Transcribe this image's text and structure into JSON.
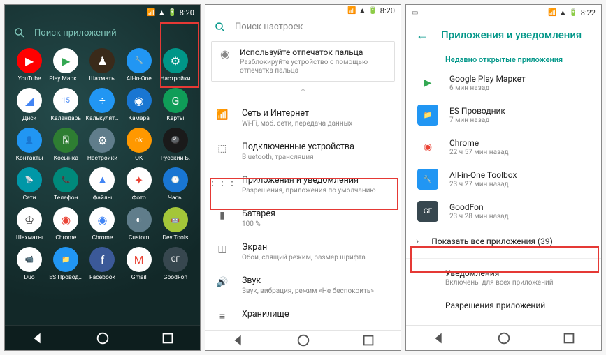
{
  "status": {
    "time1": "8:20",
    "time2": "8:20",
    "time3": "8:22"
  },
  "screen1": {
    "search": "Поиск приложений",
    "apps": [
      {
        "name": "YouTube",
        "bg": "#ff0000",
        "glyph": "▶"
      },
      {
        "name": "Play Маркет",
        "bg": "#ffffff",
        "glyph": "▶",
        "fg": "#34a853"
      },
      {
        "name": "Шахматы",
        "bg": "#3a2a1a",
        "glyph": "♟"
      },
      {
        "name": "All-in-One",
        "bg": "#2196f3",
        "glyph": "🔧"
      },
      {
        "name": "Настройки",
        "bg": "#009688",
        "glyph": "⚙"
      },
      {
        "name": "Диск",
        "bg": "#ffffff",
        "glyph": "◢",
        "fg": "#4285f4"
      },
      {
        "name": "Календарь",
        "bg": "#ffffff",
        "glyph": "15",
        "fg": "#4285f4"
      },
      {
        "name": "Калькулятор",
        "bg": "#2196f3",
        "glyph": "÷"
      },
      {
        "name": "Камера",
        "bg": "#1976d2",
        "glyph": "◉"
      },
      {
        "name": "Карты",
        "bg": "#0f9d58",
        "glyph": "G"
      },
      {
        "name": "Контакты",
        "bg": "#2196f3",
        "glyph": "👤"
      },
      {
        "name": "Косынка",
        "bg": "#2e7d32",
        "glyph": "🂡"
      },
      {
        "name": "Настройки",
        "bg": "#607d8b",
        "glyph": "⚙"
      },
      {
        "name": "OK",
        "bg": "#ff9800",
        "glyph": "ok"
      },
      {
        "name": "Русский Б.",
        "bg": "#1a1a1a",
        "glyph": "🎱"
      },
      {
        "name": "Сети",
        "bg": "#0097a7",
        "glyph": "📡"
      },
      {
        "name": "Телефон",
        "bg": "#00897b",
        "glyph": "📞"
      },
      {
        "name": "Файлы",
        "bg": "#ffffff",
        "glyph": "▲",
        "fg": "#4285f4"
      },
      {
        "name": "Фото",
        "bg": "#ffffff",
        "glyph": "✦",
        "fg": "#ea4335"
      },
      {
        "name": "Часы",
        "bg": "#1976d2",
        "glyph": "🕐"
      },
      {
        "name": "Шахматы",
        "bg": "#ffffff",
        "glyph": "♔",
        "fg": "#333"
      },
      {
        "name": "Chrome",
        "bg": "#ffffff",
        "glyph": "◉",
        "fg": "#ea4335"
      },
      {
        "name": "Chrome",
        "bg": "#ffffff",
        "glyph": "◉",
        "fg": "#4285f4"
      },
      {
        "name": "Custom",
        "bg": "#607d8b",
        "glyph": "◐"
      },
      {
        "name": "Dev Tools",
        "bg": "#a4c639",
        "glyph": "🤖"
      },
      {
        "name": "Duo",
        "bg": "#ffffff",
        "glyph": "📹",
        "fg": "#1976d2"
      },
      {
        "name": "ES Проводн.",
        "bg": "#2196f3",
        "glyph": "📁"
      },
      {
        "name": "Facebook",
        "bg": "#3b5998",
        "glyph": "f"
      },
      {
        "name": "Gmail",
        "bg": "#ffffff",
        "glyph": "M",
        "fg": "#ea4335"
      },
      {
        "name": "GoodFon",
        "bg": "#37474f",
        "glyph": "GF"
      }
    ]
  },
  "screen2": {
    "search": "Поиск настроек",
    "fingerprint": {
      "title": "Используйте отпечаток пальца",
      "sub": "Разблокируйте устройство с помощью отпечатка пальца"
    },
    "rows": [
      {
        "icon": "wifi",
        "title": "Сеть и Интернет",
        "sub": "Wi-Fi, моб. сети, передача данных"
      },
      {
        "icon": "devices",
        "title": "Подключенные устройства",
        "sub": "Bluetooth, трансляция"
      },
      {
        "icon": "apps",
        "title": "Приложения и уведомления",
        "sub": "Разрешения, приложения по умолчанию"
      },
      {
        "icon": "battery",
        "title": "Батарея",
        "sub": "100 %"
      },
      {
        "icon": "display",
        "title": "Экран",
        "sub": "Обои, спящий режим, размер шрифта"
      },
      {
        "icon": "sound",
        "title": "Звук",
        "sub": "Звук, вибрация, режим «Не беспокоить»"
      },
      {
        "icon": "storage",
        "title": "Хранилище",
        "sub": ""
      }
    ]
  },
  "screen3": {
    "title": "Приложения и уведомления",
    "section": "Недавно открытые приложения",
    "recent": [
      {
        "name": "Google Play Маркет",
        "time": "6 мин назад",
        "bg": "#ffffff",
        "glyph": "▶",
        "fg": "#34a853"
      },
      {
        "name": "ES Проводник",
        "time": "7 мин назад",
        "bg": "#2196f3",
        "glyph": "📁"
      },
      {
        "name": "Chrome",
        "time": "22 ч 57 мин назад",
        "bg": "#ffffff",
        "glyph": "◉",
        "fg": "#ea4335"
      },
      {
        "name": "All-in-One Toolbox",
        "time": "23 ч 27 мин назад",
        "bg": "#2196f3",
        "glyph": "🔧"
      },
      {
        "name": "GoodFon",
        "time": "23 ч 28 мин назад",
        "bg": "#37474f",
        "glyph": "GF"
      }
    ],
    "showall": "Показать все приложения (39)",
    "notif": {
      "title": "Уведомления",
      "sub": "Включены для всех приложений"
    },
    "perms": {
      "title": "Разрешения приложений"
    }
  }
}
